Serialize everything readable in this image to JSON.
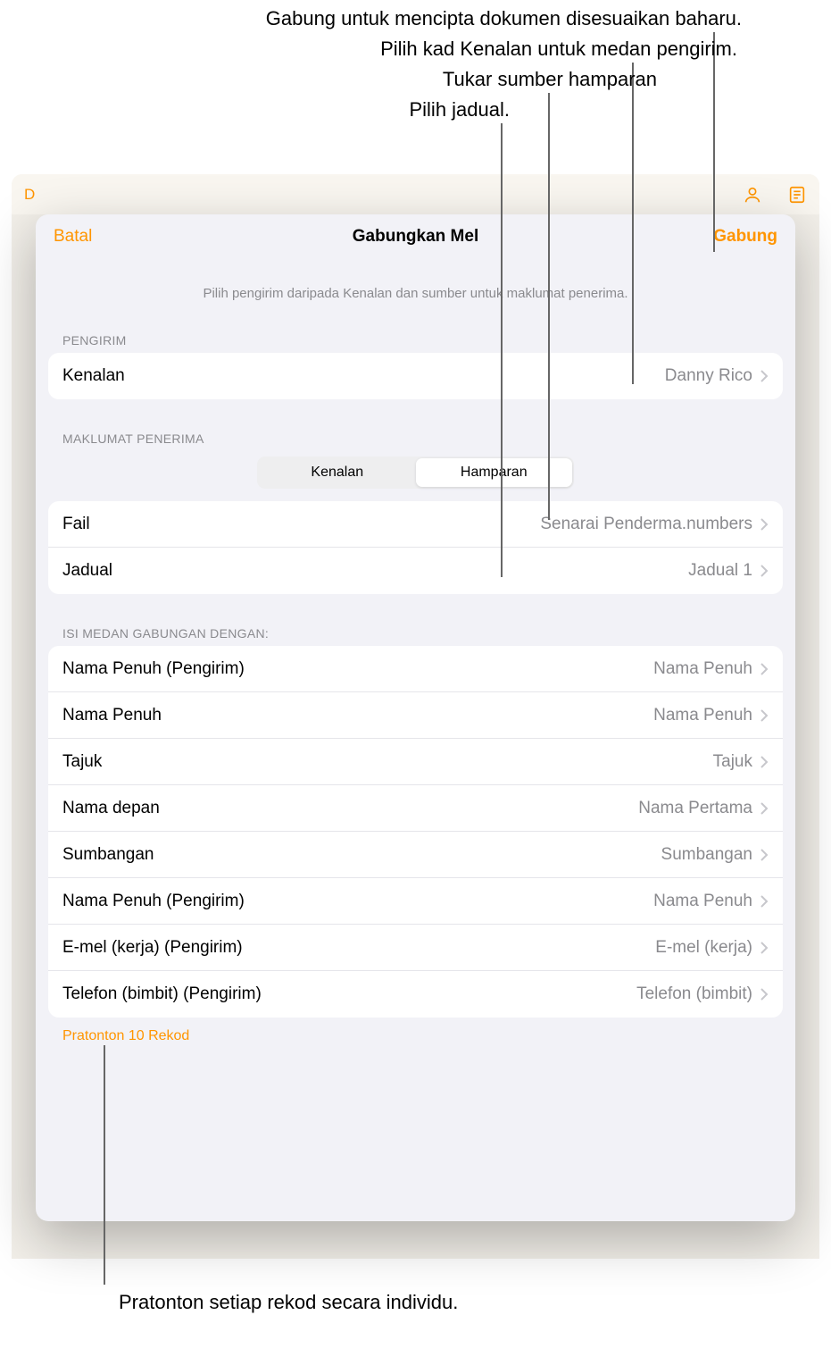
{
  "callouts": {
    "c1": "Gabung untuk mencipta dokumen disesuaikan baharu.",
    "c2": "Pilih kad Kenalan untuk medan pengirim.",
    "c3": "Tukar sumber hamparan",
    "c4": "Pilih jadual.",
    "bottom": "Pratonton setiap rekod secara individu."
  },
  "toolbar": {
    "back_letter": "D"
  },
  "modal": {
    "cancel": "Batal",
    "title": "Gabungkan Mel",
    "merge": "Gabung",
    "instruction": "Pilih pengirim daripada Kenalan dan sumber untuk maklumat penerima."
  },
  "sender": {
    "section": "PENGIRIM",
    "label": "Kenalan",
    "value": "Danny Rico"
  },
  "recipient": {
    "section": "MAKLUMAT PENERIMA",
    "seg_contacts": "Kenalan",
    "seg_spreadsheet": "Hamparan",
    "file_label": "Fail",
    "file_value": "Senarai Penderma.numbers",
    "table_label": "Jadual",
    "table_value": "Jadual 1"
  },
  "fields": {
    "section": "ISI MEDAN GABUNGAN DENGAN:",
    "items": [
      {
        "label": "Nama Penuh (Pengirim)",
        "value": "Nama Penuh"
      },
      {
        "label": "Nama Penuh",
        "value": "Nama Penuh"
      },
      {
        "label": "Tajuk",
        "value": "Tajuk"
      },
      {
        "label": "Nama depan",
        "value": "Nama Pertama"
      },
      {
        "label": "Sumbangan",
        "value": "Sumbangan"
      },
      {
        "label": "Nama Penuh (Pengirim)",
        "value": "Nama Penuh"
      },
      {
        "label": "E-mel (kerja) (Pengirim)",
        "value": "E-mel (kerja)"
      },
      {
        "label": "Telefon (bimbit) (Pengirim)",
        "value": "Telefon (bimbit)"
      }
    ]
  },
  "preview": {
    "label": "Pratonton 10 Rekod"
  }
}
